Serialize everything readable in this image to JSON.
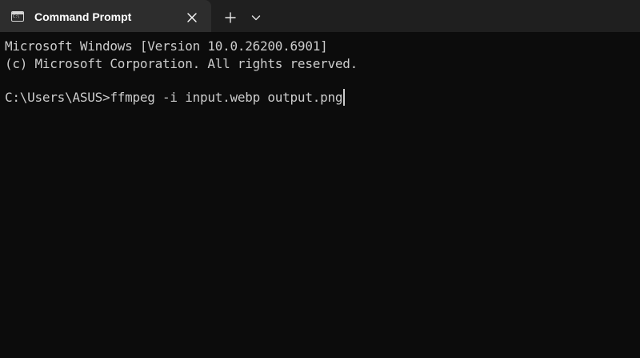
{
  "window": {
    "tabs": [
      {
        "title": "Command Prompt",
        "icon": "command-prompt-icon",
        "icon_glyph": "C:\\"
      }
    ],
    "close_icon": "close-icon",
    "new_tab_icon": "plus-icon",
    "dropdown_icon": "chevron-down-icon"
  },
  "terminal": {
    "lines": [
      "Microsoft Windows [Version 10.0.26200.6901]",
      "(c) Microsoft Corporation. All rights reserved.",
      "",
      "C:\\Users\\ASUS>ffmpeg -i input.webp output.png"
    ]
  },
  "colors": {
    "background": "#0c0c0c",
    "tab_bar": "#1f1f1f",
    "active_tab": "#2d2d2d",
    "text": "#cccccc"
  }
}
